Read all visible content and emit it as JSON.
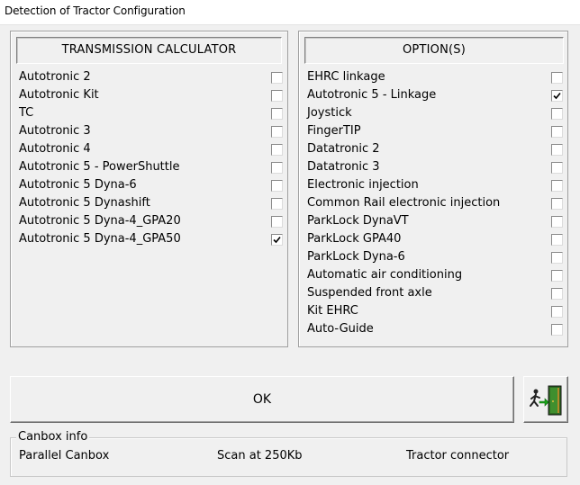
{
  "window": {
    "title": "Detection of Tractor Configuration"
  },
  "transmission": {
    "header": "TRANSMISSION CALCULATOR",
    "items": [
      {
        "label": "Autotronic 2",
        "checked": false
      },
      {
        "label": "Autotronic Kit",
        "checked": false
      },
      {
        "label": "TC",
        "checked": false
      },
      {
        "label": "Autotronic 3",
        "checked": false
      },
      {
        "label": "Autotronic 4",
        "checked": false
      },
      {
        "label": "Autotronic 5 - PowerShuttle",
        "checked": false
      },
      {
        "label": "Autotronic 5 Dyna-6",
        "checked": false
      },
      {
        "label": "Autotronic 5 Dynashift",
        "checked": false
      },
      {
        "label": "Autotronic 5 Dyna-4_GPA20",
        "checked": false
      },
      {
        "label": "Autotronic 5 Dyna-4_GPA50",
        "checked": true
      }
    ]
  },
  "options": {
    "header": "OPTION(S)",
    "items": [
      {
        "label": "EHRC linkage",
        "checked": false
      },
      {
        "label": "Autotronic 5 - Linkage",
        "checked": true
      },
      {
        "label": "Joystick",
        "checked": false
      },
      {
        "label": "FingerTIP",
        "checked": false
      },
      {
        "label": "Datatronic 2",
        "checked": false
      },
      {
        "label": "Datatronic 3",
        "checked": false
      },
      {
        "label": "Electronic injection",
        "checked": false
      },
      {
        "label": "Common Rail electronic injection",
        "checked": false
      },
      {
        "label": "ParkLock DynaVT",
        "checked": false
      },
      {
        "label": "ParkLock GPA40",
        "checked": false
      },
      {
        "label": "ParkLock Dyna-6",
        "checked": false
      },
      {
        "label": "Automatic air conditioning",
        "checked": false
      },
      {
        "label": "Suspended front axle",
        "checked": false
      },
      {
        "label": "Kit EHRC",
        "checked": false
      },
      {
        "label": "Auto-Guide",
        "checked": false
      }
    ]
  },
  "actions": {
    "ok_label": "OK",
    "exit_icon": "exit-door-icon"
  },
  "canbox": {
    "legend": "Canbox info",
    "type": "Parallel Canbox",
    "scan": "Scan at 250Kb",
    "connector": "Tractor connector"
  },
  "colors": {
    "background": "#f0f0f0",
    "door": "#3a7d2a",
    "arrow": "#1aa31a"
  }
}
